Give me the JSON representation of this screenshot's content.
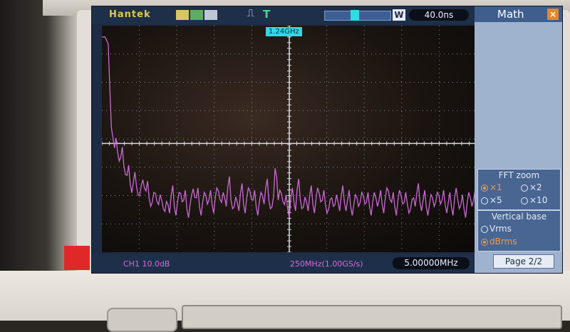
{
  "header": {
    "brand": "Hantek",
    "timebase": "40.0ns",
    "window_label": "W",
    "trigger_label": "T",
    "cursor_freq": "1.24GHz"
  },
  "footer": {
    "ch1_scale": "CH1 10.0dB",
    "sample_info": "250MHz(1.00GS/s)",
    "center_freq": "5.00000MHz"
  },
  "menu": {
    "title": "Math",
    "close": "×",
    "fft_zoom": {
      "title": "FFT zoom",
      "options": [
        "×1",
        "×2",
        "×5",
        "×10"
      ],
      "selected": "×1"
    },
    "vertical_base": {
      "title": "Vertical base",
      "options": [
        "Vrms",
        "dBrms"
      ],
      "selected": "dBrms"
    },
    "page": "Page 2/2"
  },
  "icons": [
    "mode-icons",
    "trigger-edge-icon",
    "memory-position-bar"
  ],
  "colors": {
    "trace": "#d56ee0",
    "screen_bg": "#1d2c44",
    "brand": "#e4c84a",
    "accent": "#35d6e6",
    "selected": "#e69c52"
  },
  "chart_data": {
    "type": "line",
    "series": [
      {
        "values": [
          5,
          5,
          8,
          45,
          54,
          56,
          58,
          62,
          66,
          70,
          69,
          71,
          75,
          68,
          73,
          76,
          78,
          74,
          79,
          77,
          82,
          79,
          75,
          80,
          78,
          74,
          77,
          81,
          79,
          72,
          76,
          80,
          78,
          75,
          77,
          79,
          76,
          73,
          78,
          76,
          71,
          77,
          80,
          78,
          74,
          79,
          76,
          73,
          77,
          80,
          78,
          75,
          72,
          77,
          80,
          63,
          77,
          74,
          79,
          81,
          76,
          78,
          72,
          77,
          80,
          78,
          75,
          79,
          76,
          74,
          77,
          79,
          81,
          76,
          79,
          78,
          75,
          78,
          77,
          80,
          79,
          76,
          78,
          75,
          78,
          80,
          78,
          76,
          77,
          79,
          76,
          73,
          78,
          80,
          77,
          75,
          78,
          79,
          81,
          76,
          74,
          78,
          77,
          80,
          79,
          76,
          78,
          75,
          77,
          79,
          78,
          80,
          76,
          77,
          79,
          81,
          78,
          76,
          77,
          80
        ]
      }
    ],
    "x_divisions": 10,
    "y_divisions": 8,
    "grid": true
  }
}
